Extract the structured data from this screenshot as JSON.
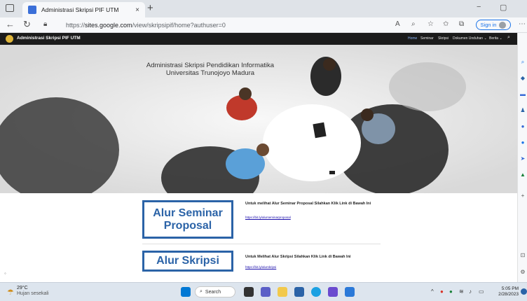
{
  "browser": {
    "tab_title": "Administrasi Skripsi PIF UTM",
    "tab_close": "×",
    "new_tab": "+",
    "url_scheme": "https://",
    "url_host": "sites.google.com",
    "url_path": "/view/skripsipif/home?authuser=0",
    "signin_label": "Sign in",
    "minimize": "−",
    "restore": "▢"
  },
  "site": {
    "name": "Administrasi Skripsi PIF UTM",
    "nav": [
      {
        "label": "Home",
        "active": true
      },
      {
        "label": "Seminar"
      },
      {
        "label": "Skripsi"
      },
      {
        "label": "Dokumen Unduhan ⌄"
      },
      {
        "label": "Berita ⌄"
      }
    ]
  },
  "hero": {
    "title_line1": "Administrasi Skripsi Pendidikan Informatika",
    "title_line2": "Universitas Trunojoyo Madura"
  },
  "sections": [
    {
      "image_text_1": "Alur Seminar",
      "image_text_2": "Proposal",
      "heading": "Untuk melihat Alur Seminar Proposal Silahkan Klik Link di Bawah Ini",
      "link": "https://bit.ly/alurseminarproposal"
    },
    {
      "image_text_1": "Alur Skripsi",
      "heading": "Untuk Melihat Alur Skripsi Silahkan Klik Link di Bawah Ini",
      "link": "https://bit.ly/alurskripsi"
    }
  ],
  "taskbar": {
    "temperature": "29°C",
    "weather": "Hujan sesekali",
    "search_label": "Search",
    "time": "5:05 PM",
    "date": "2/28/2023",
    "colors": {
      "accent": "#2b63a7"
    }
  }
}
